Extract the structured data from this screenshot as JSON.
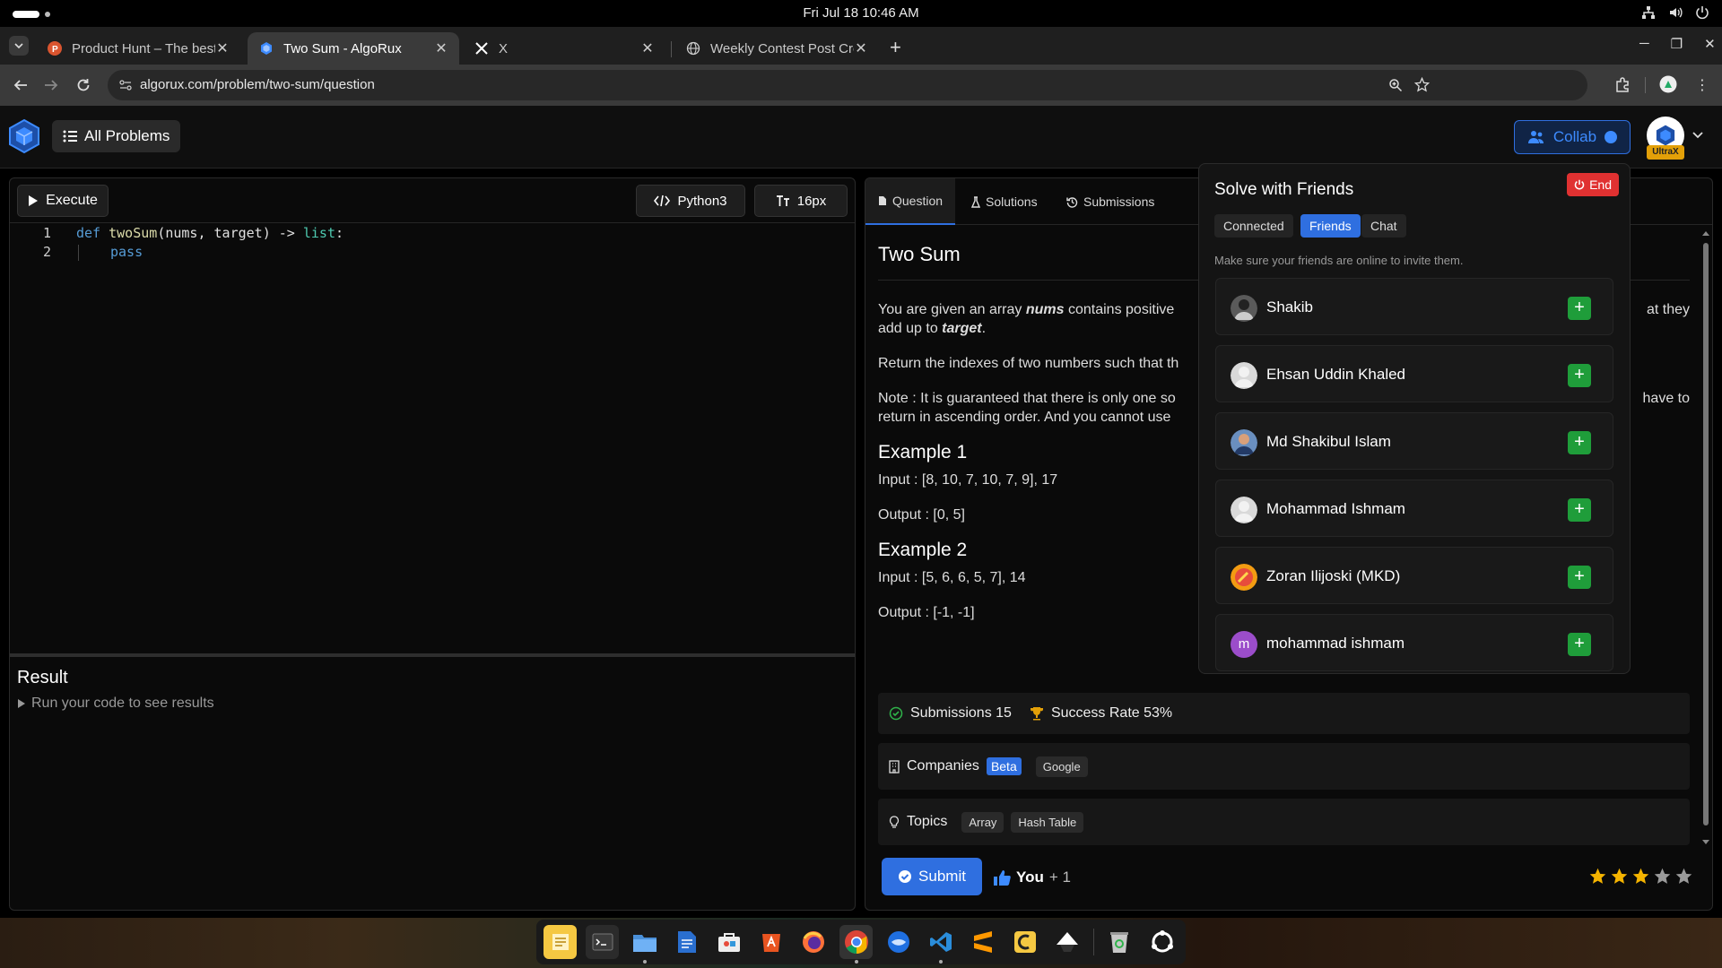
{
  "system": {
    "clock": "Fri Jul 18  10:46 AM"
  },
  "browser": {
    "tabs": [
      {
        "title": "Product Hunt – The best",
        "favicon": "product-hunt-icon"
      },
      {
        "title": "Two Sum - AlgoRux",
        "favicon": "algorux-icon",
        "active": true
      },
      {
        "title": "X",
        "favicon": "x-logo-icon"
      },
      {
        "title": "Weekly Contest Post Cre",
        "favicon": "globe-icon"
      }
    ],
    "url": "algorux.com/problem/two-sum/question"
  },
  "header": {
    "all_problems": "All Problems",
    "collab": "Collab",
    "badge": "UltraX"
  },
  "editor": {
    "execute": "Execute",
    "language": "Python3",
    "font_size": "16px",
    "lines": [
      {
        "num": "1",
        "parts": [
          "def",
          "twoSum",
          "(nums, target)",
          "->",
          "list",
          ":"
        ]
      },
      {
        "num": "2",
        "parts": [
          "pass"
        ]
      }
    ],
    "result_title": "Result",
    "result_hint": "Run your code to see results"
  },
  "problem": {
    "tabs": [
      "Question",
      "Solutions",
      "Submissions"
    ],
    "title": "Two Sum",
    "desc_1a": "You are given an array ",
    "desc_1b": "nums",
    "desc_1c": " contains positive",
    "desc_1d": "at they",
    "desc_1e": "add up to ",
    "desc_1f": "target",
    "desc_1g": ".",
    "desc_2": "Return the indexes of two numbers such that th",
    "desc_3a": "Note : It is guaranteed that there is only one so",
    "desc_3b": "have to",
    "desc_3c": "return in ascending order. And you cannot use",
    "examples": [
      {
        "title": "Example 1",
        "input": "Input : [8, 10, 7, 10, 7, 9], 17",
        "output": "Output : [0, 5]"
      },
      {
        "title": "Example 2",
        "input": "Input : [5, 6, 6, 5, 7], 14",
        "output": "Output : [-1, -1]"
      }
    ],
    "submissions": "Submissions 15",
    "success_rate": "Success Rate 53%",
    "companies_label": "Companies",
    "beta": "Beta",
    "companies": [
      "Google"
    ],
    "topics_label": "Topics",
    "topics": [
      "Array",
      "Hash Table"
    ],
    "submit": "Submit",
    "likes": "You",
    "likes_extra": " + 1",
    "rating": 3,
    "rating_max": 5
  },
  "collab": {
    "title": "Solve with Friends",
    "end": "End",
    "tabs": [
      "Connected",
      "Friends",
      "Chat"
    ],
    "active_tab": "Friends",
    "hint": "Make sure your friends are online to invite them.",
    "friends": [
      {
        "name": "Shakib"
      },
      {
        "name": "Ehsan Uddin Khaled"
      },
      {
        "name": "Md Shakibul Islam"
      },
      {
        "name": "Mohammad Ishmam"
      },
      {
        "name": "Zoran Ilijoski (MKD)"
      },
      {
        "name": "mohammad ishmam",
        "initial": "m"
      }
    ],
    "add": "+"
  },
  "colors": {
    "accent": "#2f6fe0",
    "danger": "#e03131",
    "success": "#1f9d3a",
    "star": "#f5b400"
  }
}
